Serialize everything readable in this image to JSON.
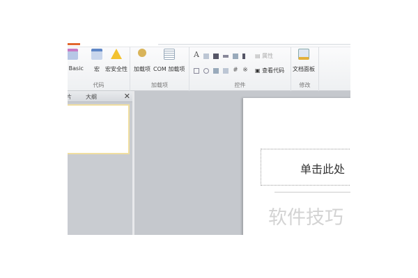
{
  "ribbon": {
    "groups": [
      {
        "label": "代码",
        "buttons": [
          "al Basic",
          "宏",
          "宏安全性"
        ]
      },
      {
        "label": "加载项",
        "buttons": [
          "加载项",
          "COM 加载项"
        ]
      },
      {
        "label": "控件",
        "buttons": [
          "属性",
          "查看代码"
        ]
      },
      {
        "label": "修改",
        "buttons": [
          "文档面板"
        ]
      }
    ]
  },
  "panel": {
    "tabs": [
      "片",
      "大纲"
    ],
    "close": "✕"
  },
  "slide": {
    "title_placeholder": "单击此处",
    "watermark": "软件技巧"
  }
}
